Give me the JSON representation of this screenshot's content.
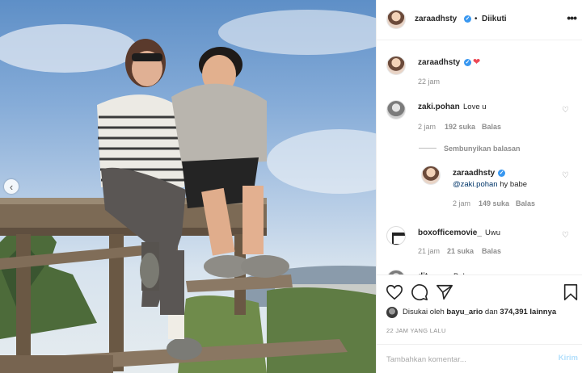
{
  "header": {
    "username": "zaraadhsty",
    "separator": "•",
    "follow_status": "Diikuti",
    "more_label": "•••"
  },
  "caption": {
    "username": "zaraadhsty",
    "time": "22 jam"
  },
  "comments": [
    {
      "username": "zaki.pohan",
      "text": "Love u",
      "time": "2 jam",
      "likes": "192 suka",
      "reply_label": "Balas"
    },
    {
      "username": "boxofficemovie_",
      "text": "Uwu",
      "time": "21 jam",
      "likes": "21 suka",
      "reply_label": "Balas"
    }
  ],
  "hide_replies_label": "Sembunyikan balasan",
  "reply": {
    "username": "zaraadhsty",
    "mention": "@zaki.pohan",
    "text": " hy babe",
    "time": "2 jam",
    "likes": "149 suka",
    "reply_label": "Balas"
  },
  "partial_comment": {
    "username": "dit...",
    "text": "Bab..."
  },
  "likes_line": {
    "prefix": "Disukai oleh ",
    "user": "bayu_ario",
    "middle": " dan ",
    "count": "374,391 lainnya"
  },
  "post_date": "22 JAM YANG LALU",
  "comment_box": {
    "placeholder": "Tambahkan komentar...",
    "post_label": "Kirim"
  },
  "icons": {
    "verified": "verified-badge-icon",
    "like": "heart-outline-icon",
    "comment": "comment-bubble-icon",
    "share": "paper-plane-icon",
    "save": "bookmark-icon",
    "prev": "chevron-left-icon"
  },
  "colors": {
    "verified": "#3897f0",
    "heart": "#ed4956",
    "post_button": "#b2dffc",
    "muted": "#8e8e8e"
  }
}
